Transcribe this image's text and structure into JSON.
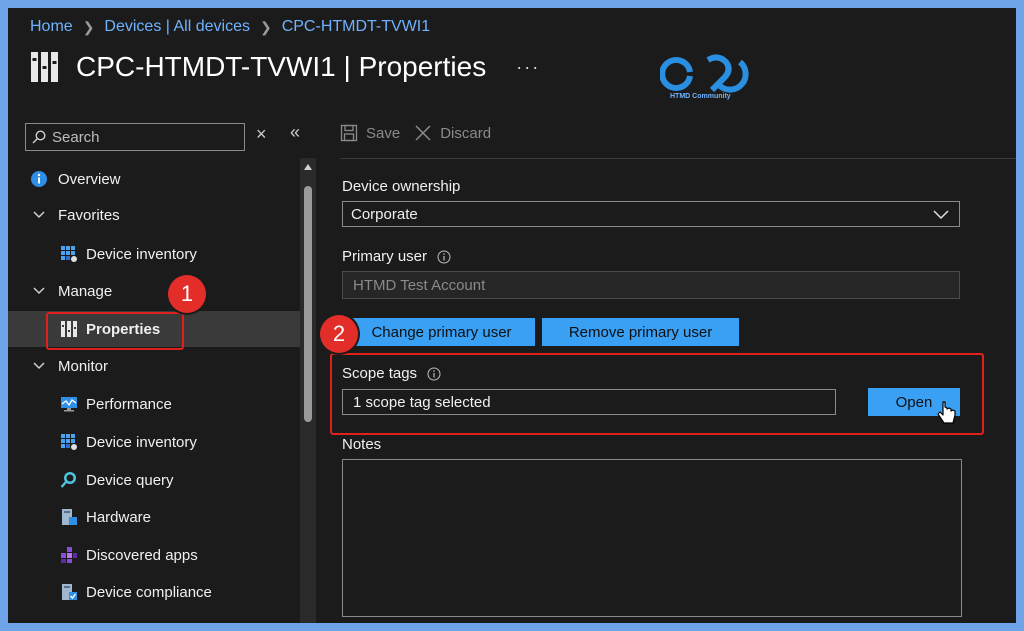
{
  "breadcrumb": {
    "items": [
      "Home",
      "Devices | All devices",
      "CPC-HTMDT-TVWI1"
    ]
  },
  "header": {
    "title": "CPC-HTMDT-TVWI1 | Properties",
    "more": "···"
  },
  "logo": {
    "caption": "HTMD Community"
  },
  "search": {
    "placeholder": "Search",
    "clear": "×",
    "collapse": "«"
  },
  "sidebar": {
    "items": [
      {
        "label": "Overview",
        "icon": "info-icon"
      },
      {
        "label": "Favorites",
        "icon": "chevron-down-icon"
      },
      {
        "label": "Device inventory",
        "icon": "device-inventory-icon"
      },
      {
        "label": "Manage",
        "icon": "chevron-down-icon"
      },
      {
        "label": "Properties",
        "icon": "properties-icon"
      },
      {
        "label": "Monitor",
        "icon": "chevron-down-icon"
      },
      {
        "label": "Performance",
        "icon": "performance-icon"
      },
      {
        "label": "Device inventory",
        "icon": "device-inventory-icon"
      },
      {
        "label": "Device query",
        "icon": "device-query-icon"
      },
      {
        "label": "Hardware",
        "icon": "hardware-icon"
      },
      {
        "label": "Discovered apps",
        "icon": "discovered-apps-icon"
      },
      {
        "label": "Device compliance",
        "icon": "device-compliance-icon"
      }
    ]
  },
  "toolbar": {
    "save_label": "Save",
    "discard_label": "Discard"
  },
  "form": {
    "ownership_label": "Device ownership",
    "ownership_value": "Corporate",
    "primary_user_label": "Primary user",
    "primary_user_value": "HTMD Test Account",
    "change_primary_user": "Change primary user",
    "remove_primary_user": "Remove primary user",
    "scope_tags_label": "Scope tags",
    "scope_tags_value": "1 scope tag selected",
    "open_label": "Open",
    "notes_label": "Notes",
    "notes_value": ""
  },
  "annotations": {
    "badge1": "1",
    "badge2": "2",
    "highlight_color": "#e0201c"
  },
  "colors": {
    "accent": "#3aa0f3",
    "link": "#6fb3ff",
    "background": "#1b1b1b",
    "frame": "#6fa3e8"
  }
}
